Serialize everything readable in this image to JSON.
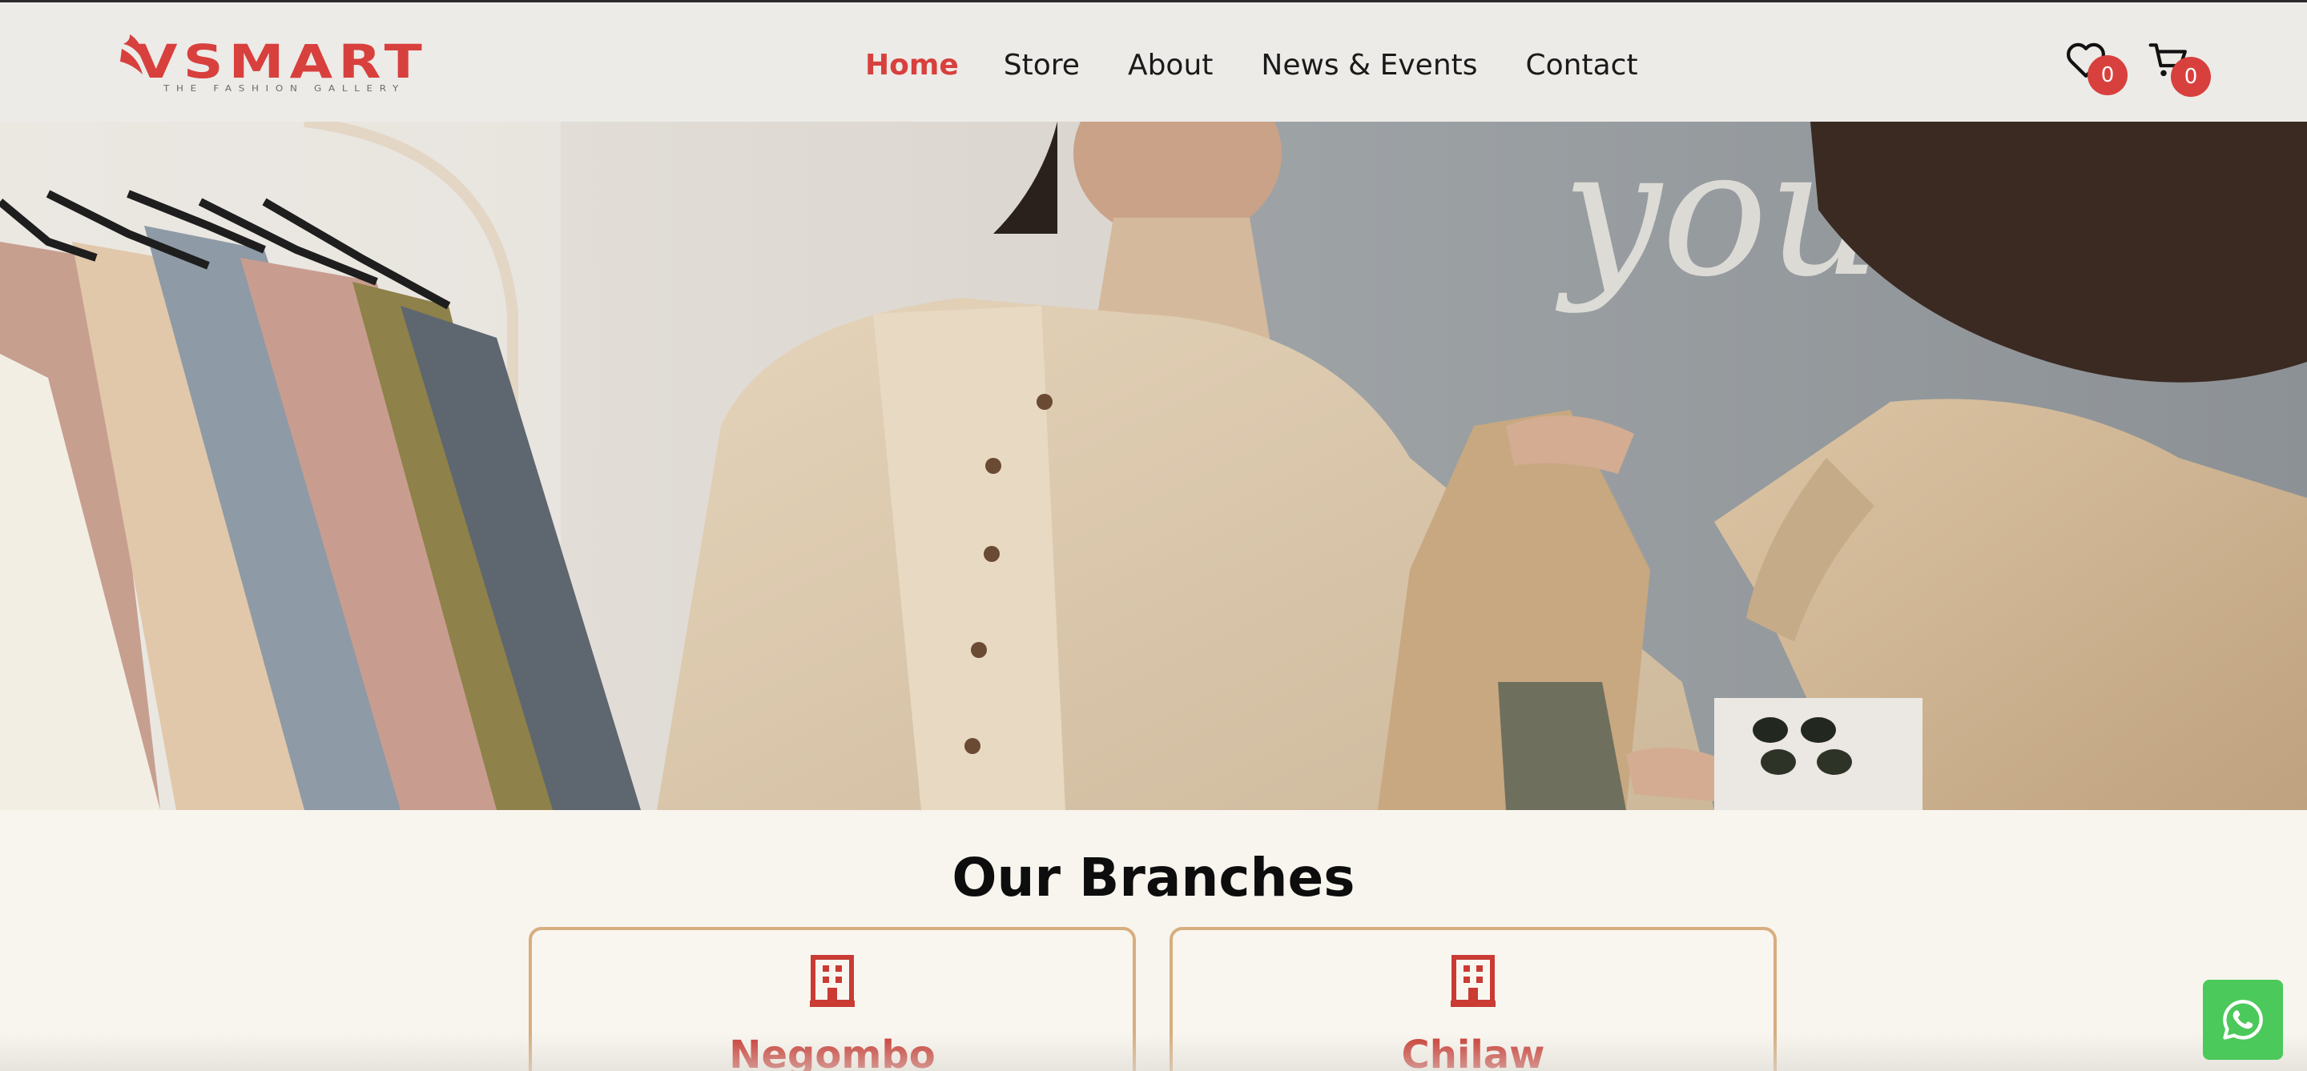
{
  "brand": {
    "logo_text": "VSMART",
    "tagline": "THE FASHION GALLERY"
  },
  "nav": {
    "items": [
      {
        "label": "Home",
        "active": true
      },
      {
        "label": "Store",
        "active": false
      },
      {
        "label": "About",
        "active": false
      },
      {
        "label": "News & Events",
        "active": false
      },
      {
        "label": "Contact",
        "active": false
      }
    ]
  },
  "header_icons": {
    "wishlist": {
      "icon": "heart-icon",
      "count": "0"
    },
    "cart": {
      "icon": "cart-icon",
      "count": "0"
    }
  },
  "hero": {
    "image": "two women examining beige shirts in a clothing store"
  },
  "branches": {
    "title": "Our Branches",
    "items": [
      {
        "name": "Negombo",
        "icon": "building-icon"
      },
      {
        "name": "Chilaw",
        "icon": "building-icon"
      }
    ]
  },
  "floating": {
    "whatsapp_icon": "whatsapp-icon"
  },
  "colors": {
    "accent": "#d8403d",
    "card_border": "#d7ae7f",
    "whatsapp": "#4bc95a"
  }
}
